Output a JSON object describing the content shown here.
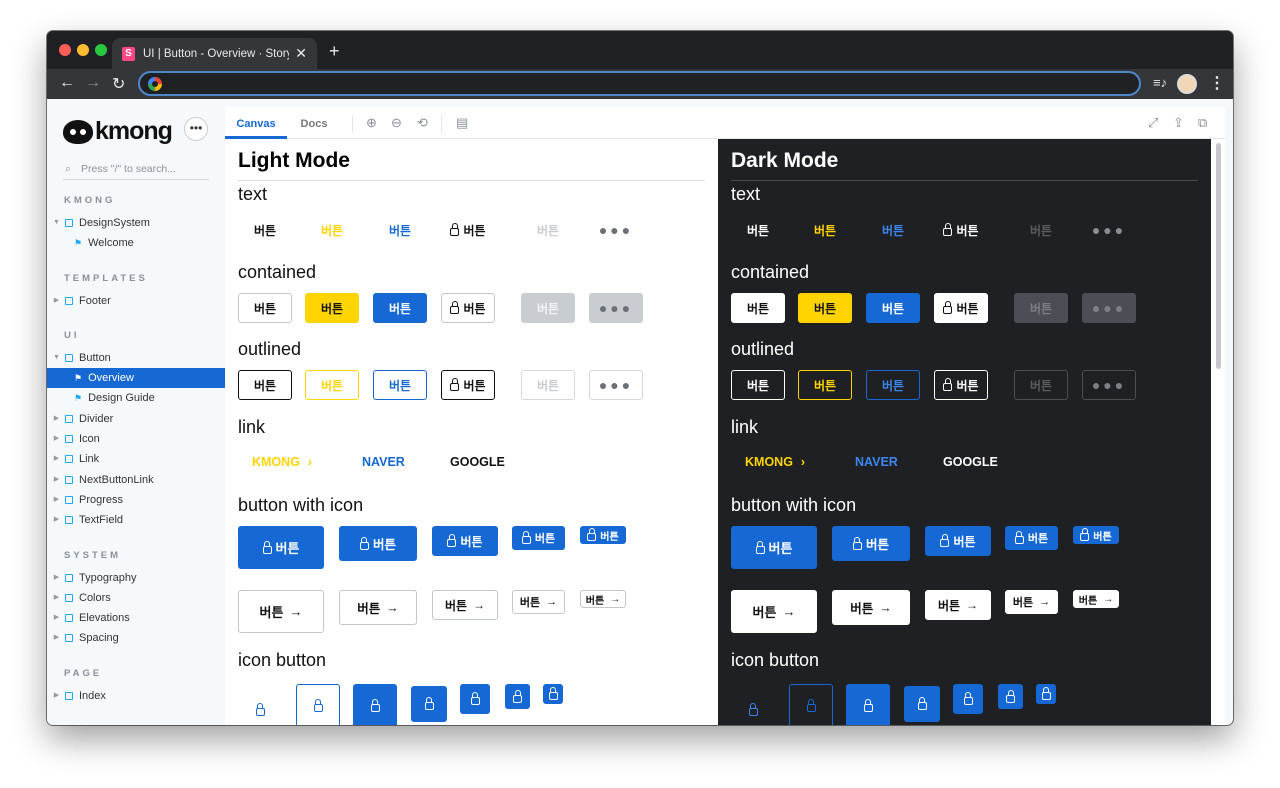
{
  "browser": {
    "tab_title": "UI | Button - Overview · Storybook",
    "favicon_letter": "S",
    "new_tab": "+",
    "close": "✕",
    "back": "←",
    "forward": "→",
    "reload": "↻",
    "media": "≡♪",
    "menu": "⋮"
  },
  "sidebar": {
    "logo_text": "kmong",
    "more": "•••",
    "search_placeholder": "Press \"/\" to search...",
    "search_icon": "⌕",
    "sections": [
      "KMONG",
      "TEMPLATES",
      "UI",
      "SYSTEM",
      "PAGE"
    ],
    "items": [
      {
        "label": "DesignSystem",
        "type": "component",
        "expanded": true
      },
      {
        "label": "Welcome",
        "type": "story"
      },
      {
        "label": "Footer",
        "type": "component"
      },
      {
        "label": "Button",
        "type": "component",
        "expanded": true
      },
      {
        "label": "Overview",
        "type": "story",
        "selected": true
      },
      {
        "label": "Design Guide",
        "type": "story"
      },
      {
        "label": "Divider",
        "type": "component"
      },
      {
        "label": "Icon",
        "type": "component"
      },
      {
        "label": "Link",
        "type": "component"
      },
      {
        "label": "NextButtonLink",
        "type": "component"
      },
      {
        "label": "Progress",
        "type": "component"
      },
      {
        "label": "TextField",
        "type": "component"
      },
      {
        "label": "Typography",
        "type": "component"
      },
      {
        "label": "Colors",
        "type": "component"
      },
      {
        "label": "Elevations",
        "type": "component"
      },
      {
        "label": "Spacing",
        "type": "component"
      },
      {
        "label": "Index",
        "type": "component"
      }
    ]
  },
  "toolbar": {
    "tabs": [
      "Canvas",
      "Docs"
    ],
    "icons": [
      "zoom-in",
      "zoom-out",
      "zoom-reset",
      "background",
      "fullscreen",
      "share",
      "copy"
    ],
    "glyphs": [
      "⊕",
      "⊖",
      "⟲",
      "▤",
      "⤢",
      "⇪",
      "⧉"
    ]
  },
  "canvas": {
    "light_title": "Light Mode",
    "dark_title": "Dark Mode",
    "sections": [
      "text",
      "contained",
      "outlined",
      "link",
      "button with icon",
      "icon button"
    ],
    "button_label": "버튼",
    "dots": "●●●",
    "arrow": "→",
    "links": [
      "KMONG",
      "NAVER",
      "GOOGLE"
    ],
    "link_chevron": "›"
  },
  "colors": {
    "primary": "#1669d4",
    "yellow": "#ffd400",
    "disabled": "#c9cdd2",
    "dark_bg": "#1f2023"
  }
}
